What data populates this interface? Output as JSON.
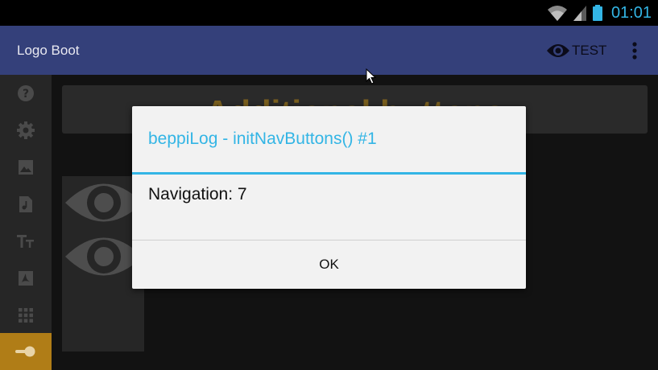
{
  "status_bar": {
    "time": "01:01",
    "icons": [
      "wifi-icon",
      "cell-signal-icon",
      "battery-icon"
    ],
    "time_color": "#33b5e5"
  },
  "app_bar": {
    "title": "Logo Boot",
    "action_label": "TEST",
    "action_icon": "eye-icon",
    "overflow_icon": "more-vert-icon",
    "background": "#34407a"
  },
  "side_rail": {
    "items": [
      {
        "icon": "help-icon",
        "active": false
      },
      {
        "icon": "settings-icon",
        "active": false
      },
      {
        "icon": "image-icon",
        "active": false
      },
      {
        "icon": "music-file-icon",
        "active": false
      },
      {
        "icon": "text-format-icon",
        "active": false
      },
      {
        "icon": "pdf-icon",
        "active": false
      },
      {
        "icon": "apps-grid-icon",
        "active": false
      },
      {
        "icon": "toggle-icon",
        "active": true
      }
    ],
    "active_color": "#b07d17"
  },
  "content": {
    "header": "Additional buttons"
  },
  "dialog": {
    "title": "beppiLog - initNavButtons() #1",
    "message": "Navigation: 7",
    "ok_label": "OK",
    "accent": "#33b5e5"
  }
}
